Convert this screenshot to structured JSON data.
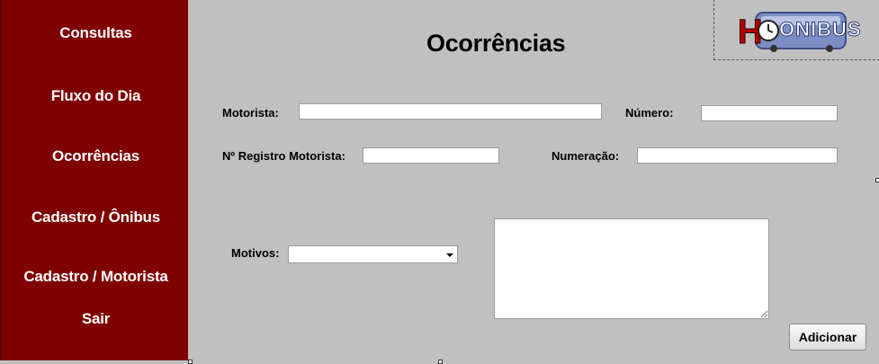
{
  "sidebar": {
    "items": [
      {
        "label": "Consultas"
      },
      {
        "label": "Fluxo do Dia"
      },
      {
        "label": "Ocorrências"
      },
      {
        "label": "Cadastro / Ônibus"
      },
      {
        "label": "Cadastro / Motorista"
      },
      {
        "label": "Sair"
      }
    ]
  },
  "logo": {
    "text": "ONIBUS",
    "initial": "H"
  },
  "page": {
    "title": "Ocorrências"
  },
  "form": {
    "motorista_label": "Motorista:",
    "motorista_value": "",
    "numero_label": "Número:",
    "numero_value": "",
    "registro_label": "Nº Registro Motorista:",
    "registro_value": "",
    "numeracao_label": "Numeração:",
    "numeracao_value": "",
    "motivos_label": "Motivos:",
    "motivos_selected": "",
    "description_value": "",
    "add_label": "Adicionar"
  },
  "colors": {
    "sidebar": "#800000",
    "background": "#c0c0c0"
  },
  "icons": [
    "clock-icon",
    "bus-icon",
    "dropdown-arrow-icon"
  ]
}
